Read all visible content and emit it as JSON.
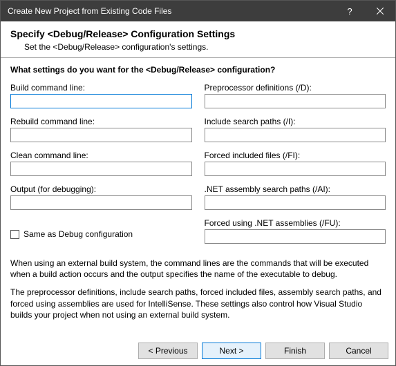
{
  "titlebar": {
    "title": "Create New Project from Existing Code Files"
  },
  "header": {
    "title": "Specify <Debug/Release> Configuration Settings",
    "subtitle": "Set the <Debug/Release> configuration's settings."
  },
  "question": "What settings do you want for the <Debug/Release> configuration?",
  "left": {
    "build_label": "Build command line:",
    "build_value": "",
    "rebuild_label": "Rebuild command line:",
    "rebuild_value": "",
    "clean_label": "Clean command line:",
    "clean_value": "",
    "output_label": "Output (for debugging):",
    "output_value": ""
  },
  "right": {
    "preproc_label": "Preprocessor definitions (/D):",
    "preproc_value": "",
    "include_label": "Include search paths (/I):",
    "include_value": "",
    "forcedinc_label": "Forced included files (/FI):",
    "forcedinc_value": "",
    "asm_label": ".NET assembly search paths (/AI):",
    "asm_value": "",
    "forcedasm_label": "Forced using .NET assemblies (/FU):",
    "forcedasm_value": ""
  },
  "checkbox": {
    "same_label": "Same as Debug configuration"
  },
  "info": {
    "p1": "When using an external build system, the command lines are the commands that will be executed when a build action occurs and the output specifies the name of the executable to debug.",
    "p2": "The preprocessor definitions, include search paths, forced included files, assembly search paths, and forced using assemblies are used for IntelliSense.  These settings also control how Visual Studio builds your project when not using an external build system."
  },
  "buttons": {
    "prev": "< Previous",
    "next": "Next >",
    "finish": "Finish",
    "cancel": "Cancel"
  }
}
